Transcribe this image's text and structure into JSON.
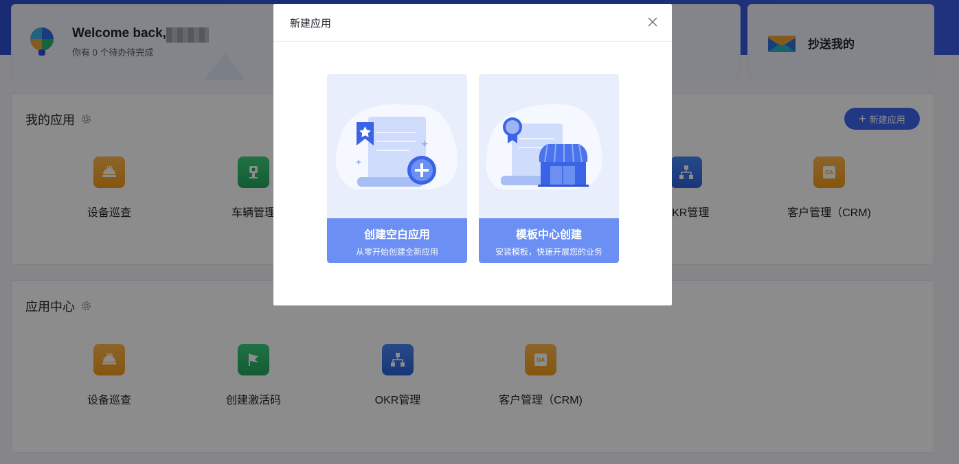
{
  "welcome": {
    "title": "Welcome back,",
    "subtitle": "你有 0 个待办待完成"
  },
  "cc": {
    "label": "抄送我的"
  },
  "my_apps": {
    "title": "我的应用",
    "new_button": "新建应用",
    "items": [
      {
        "label": "设备巡查",
        "icon": "inspection-icon",
        "color": "orange"
      },
      {
        "label": "车辆管理",
        "icon": "vehicle-icon",
        "color": "green"
      },
      {
        "label": "OKR管理",
        "icon": "org-chart-icon",
        "color": "blue"
      },
      {
        "label": "客户管理（CRM)",
        "icon": "oa-icon",
        "color": "orange"
      }
    ]
  },
  "app_center": {
    "title": "应用中心",
    "items": [
      {
        "label": "设备巡查",
        "icon": "inspection-icon",
        "color": "orange"
      },
      {
        "label": "创建激活码",
        "icon": "flag-icon",
        "color": "green"
      },
      {
        "label": "OKR管理",
        "icon": "org-chart-icon",
        "color": "blue"
      },
      {
        "label": "客户管理（CRM)",
        "icon": "oa-icon",
        "color": "orange"
      }
    ]
  },
  "modal": {
    "title": "新建应用",
    "options": [
      {
        "title": "创建空白应用",
        "subtitle": "从零开始创建全新应用"
      },
      {
        "title": "模板中心创建",
        "subtitle": "安装模板，快速开展您的业务"
      }
    ]
  },
  "colors": {
    "accent": "#3e67f3",
    "band": "#6b8ff2"
  }
}
